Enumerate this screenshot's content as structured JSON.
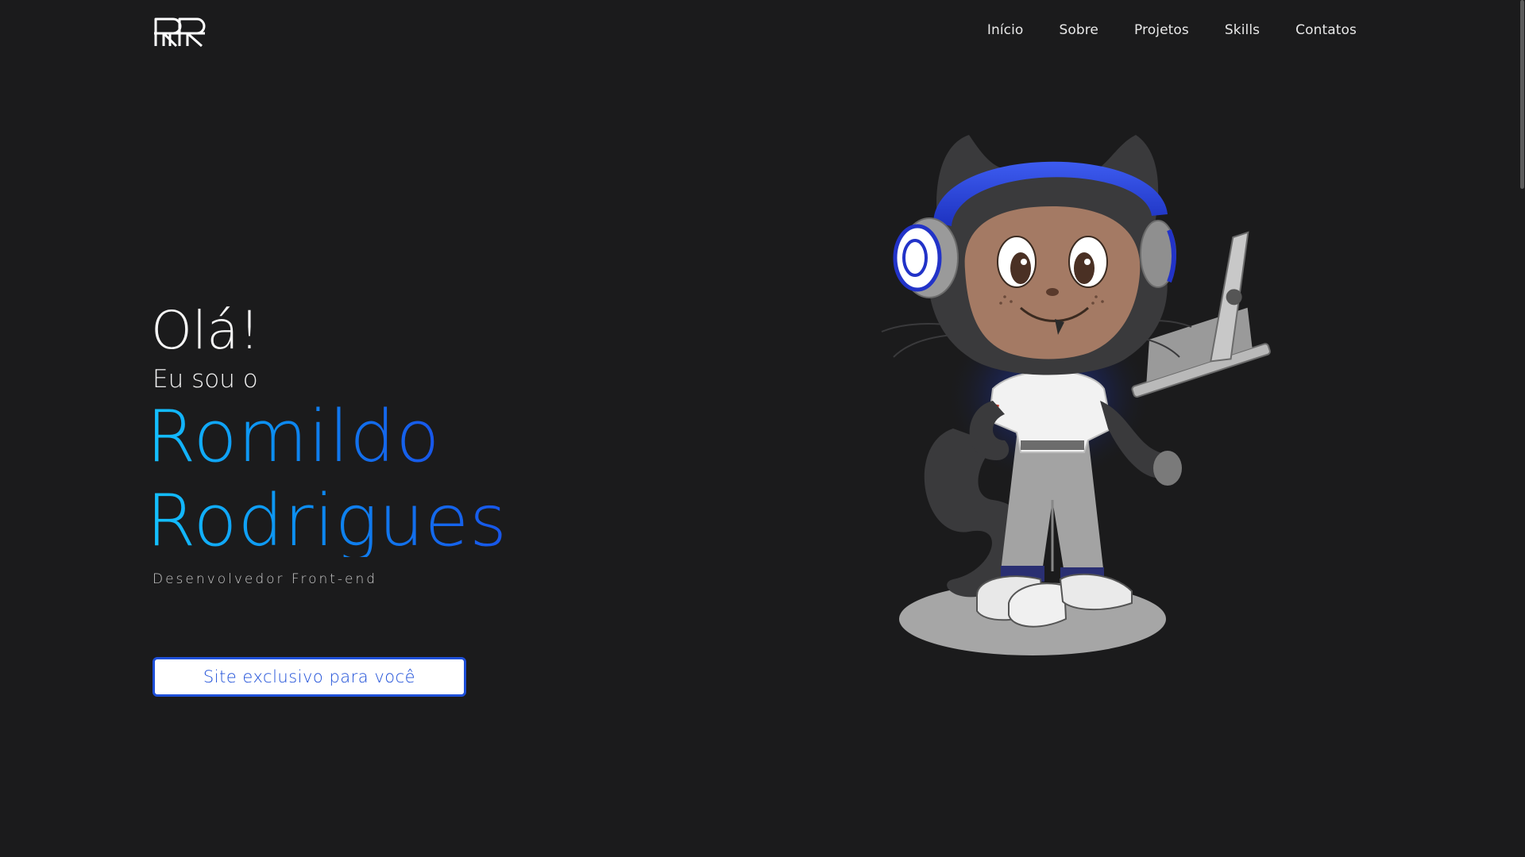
{
  "header": {
    "logo_text": "RR",
    "nav": [
      "Início",
      "Sobre",
      "Projetos",
      "Skills",
      "Contatos"
    ]
  },
  "hero": {
    "greeting": "Olá!",
    "intro": "Eu sou o",
    "first_name": "Romildo",
    "last_name": "Rodrigues",
    "role": "Desenvolvedor Front-end",
    "cta_label": "Site exclusivo para você"
  },
  "colors": {
    "background": "#1b1b1c",
    "accent_start": "#14c3ff",
    "accent_end": "#1855ea",
    "cta_border": "#1e4fd8"
  },
  "illustration": {
    "subject": "octocat-with-headphones-and-laptop"
  }
}
